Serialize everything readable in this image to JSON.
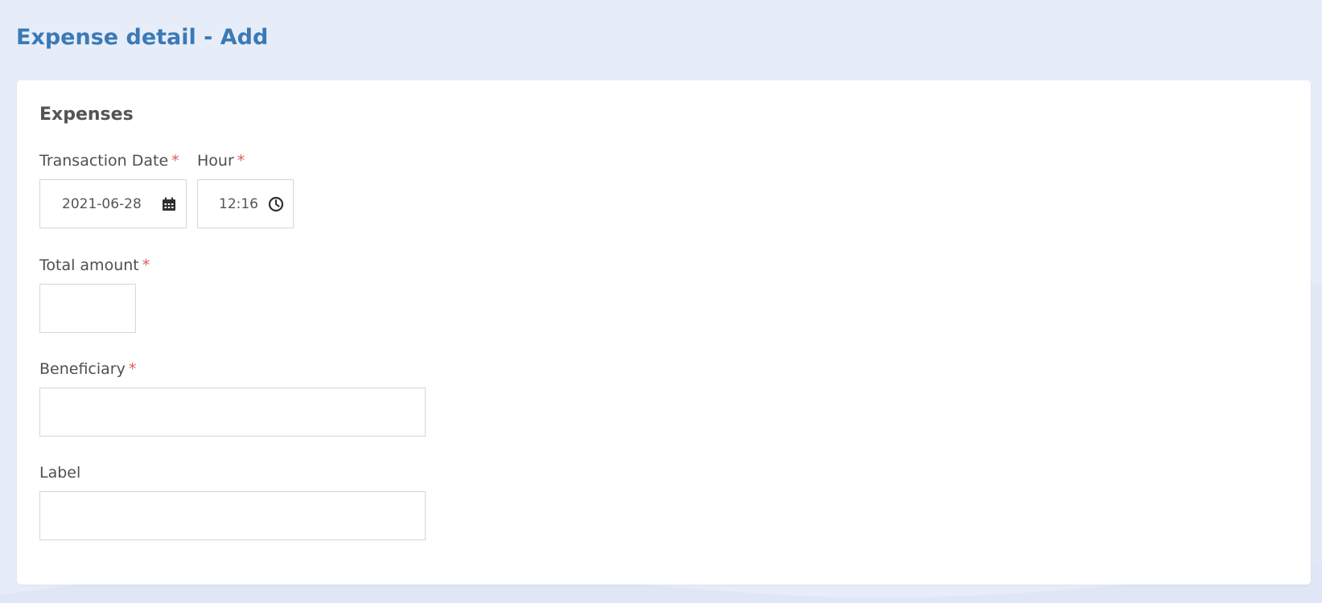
{
  "page": {
    "title": "Expense detail - Add",
    "colors": {
      "background": "#e7edf8",
      "title": "#3a7ab6",
      "required_marker": "#e05a5a",
      "card": "#ffffff",
      "input_border": "#d3d6e2"
    }
  },
  "form": {
    "section_title": "Expenses",
    "required_marker": "*",
    "transaction_date": {
      "label": "Transaction Date",
      "value": "2021-06-28",
      "icon": "calendar-icon"
    },
    "hour": {
      "label": "Hour",
      "value": "12:16",
      "icon": "clock-icon"
    },
    "total_amount": {
      "label": "Total amount",
      "value": ""
    },
    "beneficiary": {
      "label": "Beneficiary",
      "value": ""
    },
    "label_field": {
      "label": "Label",
      "value": ""
    }
  }
}
